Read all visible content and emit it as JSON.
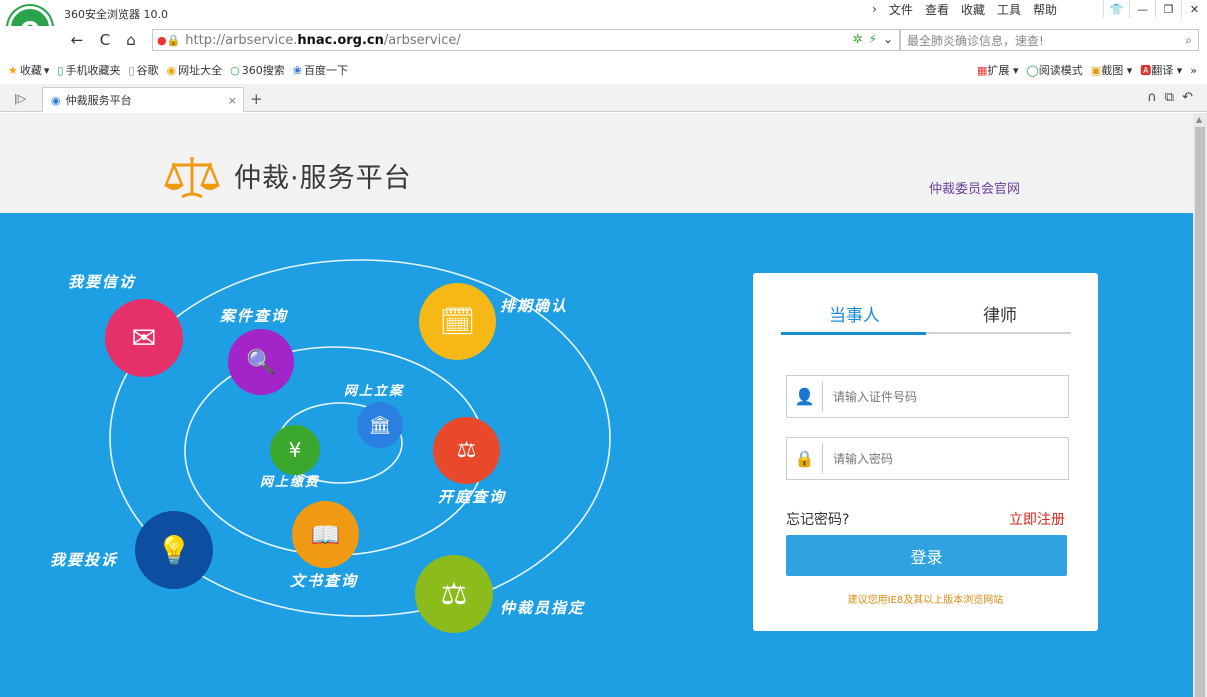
{
  "browser": {
    "app_title": "360安全浏览器 10.0",
    "logo_letter": "e",
    "menu": [
      "文件",
      "查看",
      "收藏",
      "工具",
      "帮助"
    ],
    "nav": {
      "back": "←",
      "reload": "C",
      "home": "⌂"
    },
    "url_prefix": "http://arbservice.",
    "url_host": "hnac.org.cn",
    "url_suffix": "/arbservice/",
    "search_placeholder": "最全肺炎确诊信息，速查!",
    "bookmarks": [
      "收藏",
      "手机收藏夹",
      "谷歌",
      "网址大全",
      "360搜索",
      "百度一下"
    ],
    "bookmark_tools": [
      "扩展",
      "阅读模式",
      "截图",
      "翻译"
    ],
    "tab_title": "仲裁服务平台",
    "tab_close": "×",
    "tab_add": "+"
  },
  "header": {
    "title": "仲裁·服务平台",
    "official_link": "仲裁委员会官网"
  },
  "banner": {
    "labels": {
      "petition": "我要信访",
      "case_query": "案件查询",
      "schedule": "排期确认",
      "online_filing": "网上立案",
      "online_payment": "网上缴费",
      "hearing_query": "开庭查询",
      "complaint": "我要投诉",
      "document_query": "文书查询",
      "arbitrator": "仲裁员指定"
    },
    "colors": {
      "bg": "#1e9fe4",
      "petition": "#e6306a",
      "case_query": "#a324c8",
      "schedule": "#f5b815",
      "online_filing": "#2b7fe0",
      "online_payment": "#3aa82c",
      "hearing_query": "#e8492b",
      "complaint": "#0d4ea0",
      "document_query": "#f09a14",
      "arbitrator": "#8cbc1c"
    }
  },
  "login": {
    "tab_party": "当事人",
    "tab_lawyer": "律师",
    "id_placeholder": "请输入证件号码",
    "password_placeholder": "请输入密码",
    "forgot": "忘记密码?",
    "register": "立即注册",
    "submit": "登录",
    "tip": "建议您用IE8及其以上版本浏览网站"
  }
}
